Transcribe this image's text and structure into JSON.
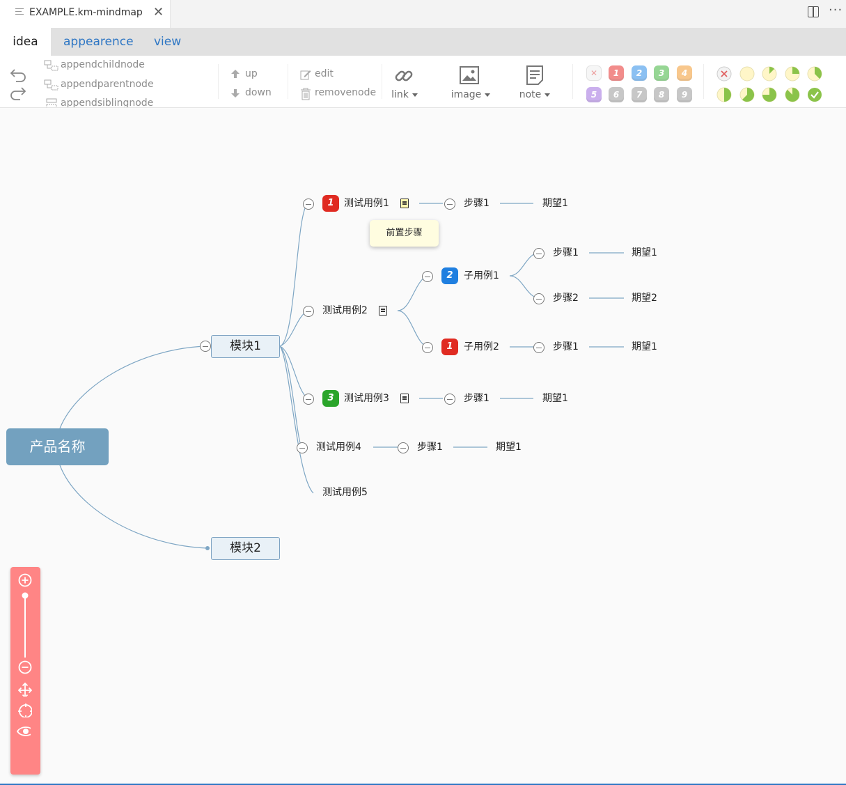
{
  "editor": {
    "file_name": "EXAMPLE.km-mindmap",
    "close_glyph": "✕",
    "more_glyph": "···"
  },
  "menu_tabs": [
    "idea",
    "appearence",
    "view"
  ],
  "active_tab": "idea",
  "toolbar": {
    "append_child": "appendchildnode",
    "append_parent": "appendparentnode",
    "append_sibling": "appendsiblingnode",
    "up": "up",
    "down": "down",
    "edit": "edit",
    "remove": "removenode",
    "link": "link",
    "image": "image",
    "note": "note",
    "priorities": [
      "1",
      "2",
      "3",
      "4",
      "5",
      "6",
      "7",
      "8",
      "9"
    ],
    "priority_colors": [
      "#e8302d",
      "#2e8ee8",
      "#42b63e",
      "#f49b2f",
      "#a06ee0",
      "#9a9a9a",
      "#9a9a9a",
      "#9a9a9a",
      "#9a9a9a"
    ],
    "progress_levels": [
      "0",
      "1/8",
      "2/8",
      "3/8",
      "4/8",
      "5/8",
      "6/8",
      "7/8",
      "done"
    ]
  },
  "mindmap": {
    "root": "产品名称",
    "modules": [
      "模块1",
      "模块2"
    ],
    "cases": [
      {
        "label": "测试用例1",
        "priority": "1",
        "steps": [
          {
            "step": "步骤1",
            "expect": "期望1"
          }
        ]
      },
      {
        "label": "测试用例2",
        "sub": [
          {
            "label": "子用例1",
            "priority": "2",
            "steps": [
              {
                "step": "步骤1",
                "expect": "期望1"
              },
              {
                "step": "步骤2",
                "expect": "期望2"
              }
            ]
          },
          {
            "label": "子用例2",
            "priority": "1",
            "steps": [
              {
                "step": "步骤1",
                "expect": "期望1"
              }
            ]
          }
        ]
      },
      {
        "label": "测试用例3",
        "priority": "3",
        "steps": [
          {
            "step": "步骤1",
            "expect": "期望1"
          }
        ]
      },
      {
        "label": "测试用例4",
        "steps": [
          {
            "step": "步骤1",
            "expect": "期望1"
          }
        ]
      },
      {
        "label": "测试用例5"
      }
    ],
    "note_tooltip": "前置步骤",
    "colors": {
      "priority_red": "#e02b22",
      "priority_blue": "#1f7fe0",
      "priority_green": "#2aa52a",
      "root_bg": "#73a1bf",
      "line": "#7ea6c4"
    }
  }
}
